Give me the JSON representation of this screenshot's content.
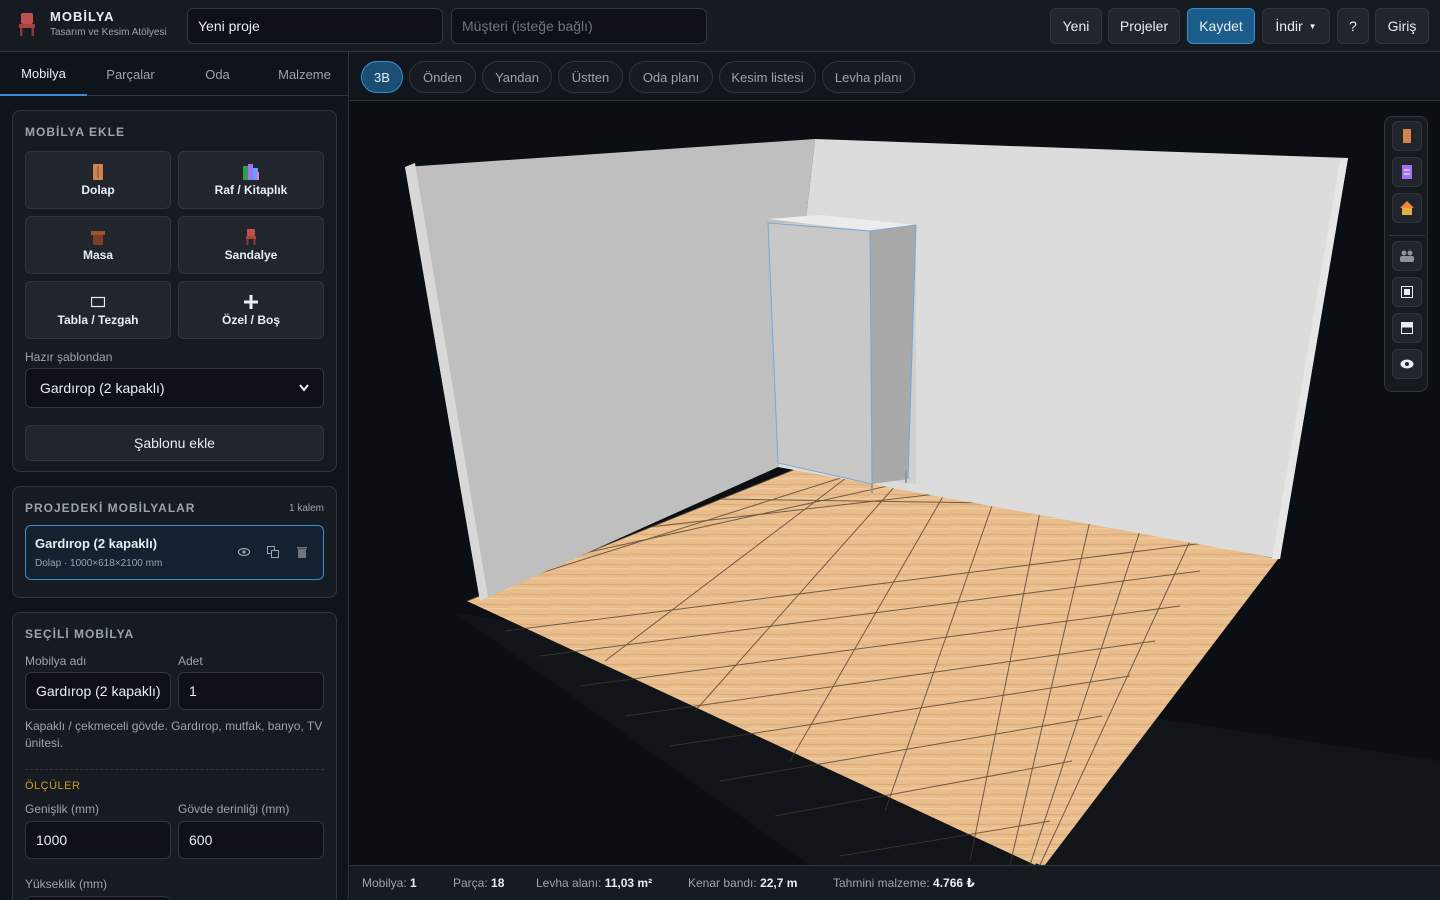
{
  "header": {
    "brand": "MOBİLYA",
    "subtitle": "Tasarım ve Kesim Atölyesi",
    "project_name": "Yeni proje",
    "customer_placeholder": "Müşteri (isteğe bağlı)",
    "buttons": {
      "new": "Yeni",
      "projects": "Projeler",
      "save": "Kaydet",
      "download": "İndir",
      "help": "?",
      "login": "Giriş"
    }
  },
  "sidebar": {
    "tabs": [
      "Mobilya",
      "Parçalar",
      "Oda",
      "Malzeme"
    ],
    "add_panel": {
      "title": "MOBİLYA EKLE",
      "buttons": [
        "Dolap",
        "Raf / Kitaplık",
        "Masa",
        "Sandalye",
        "Tabla / Tezgah",
        "Özel / Boş"
      ],
      "template_label": "Hazır şablondan",
      "template_selected": "Gardırop (2 kapaklı)",
      "add_template": "Şablonu ekle"
    },
    "project_panel": {
      "title": "PROJEDEKİ MOBİLYALAR",
      "count": "1 kalem",
      "item_name": "Gardırop (2 kapaklı)",
      "item_sub": "Dolap · 1000×618×2100 mm"
    },
    "selected_panel": {
      "title": "SEÇİLİ MOBİLYA",
      "name_label": "Mobilya adı",
      "name_value": "Gardırop (2 kapaklı)",
      "qty_label": "Adet",
      "qty_value": "1",
      "description": "Kapaklı / çekmeceli gövde. Gardırop, mutfak, banyo, TV ünitesi.",
      "dimensions_title": "ÖLÇÜLER",
      "width_label": "Genişlik (mm)",
      "width_value": "1000",
      "depth_label": "Gövde derinliği (mm)",
      "depth_value": "600",
      "height_label": "Yükseklik (mm)"
    }
  },
  "view_tabs": [
    "3B",
    "Önden",
    "Yandan",
    "Üstten",
    "Oda planı",
    "Kesim listesi",
    "Levha planı"
  ],
  "status": {
    "furniture_label": "Mobilya:",
    "furniture_value": "1",
    "parts_label": "Parça:",
    "parts_value": "18",
    "sheet_label": "Levha alanı:",
    "sheet_value": "11,03 m²",
    "edge_label": "Kenar bandı:",
    "edge_value": "22,7 m",
    "cost_label": "Tahmini malzeme:",
    "cost_value": "4.766 ₺"
  },
  "colors": {
    "accent": "#3a8ccf",
    "primary_button": "#1b5d8a",
    "section_heading": "#d29922",
    "floor": "#e8b888"
  }
}
